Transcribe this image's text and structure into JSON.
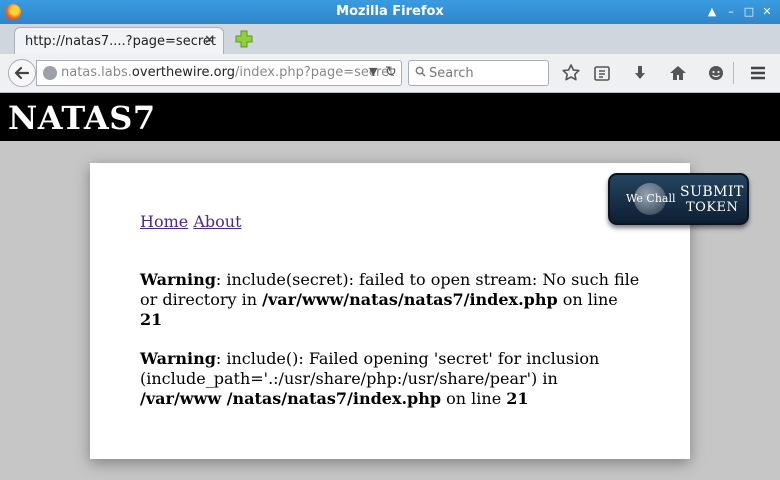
{
  "window": {
    "title": "Mozilla Firefox"
  },
  "tabs": [
    {
      "label": "http://natas7....?page=secret"
    }
  ],
  "navbar": {
    "url_prefix": "natas.labs.",
    "url_host": "overthewire.org",
    "url_path": "/index.php?page=secret",
    "search_placeholder": "Search"
  },
  "page": {
    "site_title": "NATAS7",
    "nav_links": [
      "Home",
      "About"
    ],
    "warnings": [
      {
        "label": "Warning",
        "message": ": include(secret): failed to open stream: No such file or directory in ",
        "path": "/var/www/natas/natas7/index.php",
        "line_text": " on line ",
        "line": "21"
      },
      {
        "label": "Warning",
        "message": ": include(): Failed opening 'secret' for inclusion (include_path='.:/usr/share/php:/usr/share/pear') in ",
        "path": "/var/www /natas/natas7/index.php",
        "line_text": " on line ",
        "line": "21"
      }
    ],
    "badge": {
      "logo_text": "We Chall",
      "line1": "SUBMIT",
      "line2": "TOKEN"
    }
  },
  "colors": {
    "titlebar": "#2f86c9",
    "header_bg": "#000000",
    "link": "#4a2a8c",
    "page_bg": "#c6c6c6"
  }
}
